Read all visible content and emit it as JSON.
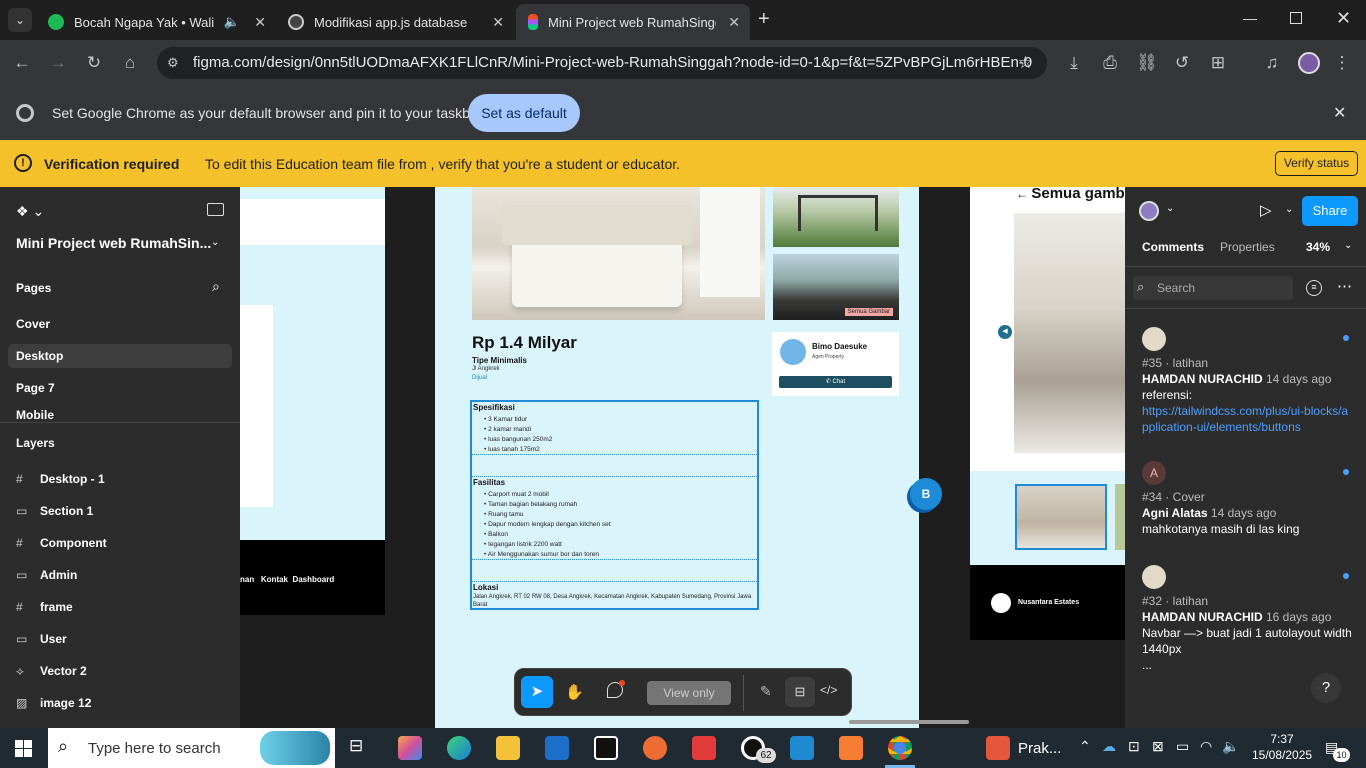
{
  "tabs": [
    {
      "title": "Bocah Ngapa Yak • Wali",
      "color": "#1db954"
    },
    {
      "title": "Modifikasi app.js database",
      "color": "#d0d0d0"
    },
    {
      "title": "Mini Project web RumahSinggah",
      "color": "#f24e1e"
    }
  ],
  "address": {
    "url": "figma.com/design/0nn5tlUODmaAFXK1FLlCnR/Mini-Project-web-RumahSinggah?node-id=0-1&p=f&t=5ZPvBPGjLm6rHBEn-0"
  },
  "infobar": {
    "text": "Set Google Chrome as your default browser and pin it to your taskbar",
    "button": "Set as default"
  },
  "verification": {
    "title": "Verification required",
    "text": "To edit this Education team file from , verify that you're a student or educator.",
    "button": "Verify status"
  },
  "left_panel": {
    "file_name": "Mini Project web RumahSin...",
    "pages_heading": "Pages",
    "pages": [
      "Cover",
      "Desktop",
      "Page 7",
      "Mobile"
    ],
    "layers_heading": "Layers",
    "layers": [
      {
        "icon": "#",
        "label": "Desktop - 1"
      },
      {
        "icon": "▭",
        "label": "Section 1"
      },
      {
        "icon": "#",
        "label": "Component"
      },
      {
        "icon": "▭",
        "label": "Admin"
      },
      {
        "icon": "#",
        "label": "frame"
      },
      {
        "icon": "▭",
        "label": "User"
      },
      {
        "icon": "⟡",
        "label": "Vector 2"
      },
      {
        "icon": "▨",
        "label": "image 12"
      }
    ]
  },
  "canvas": {
    "left_footer_links": "nan   Kontak  Dashboard",
    "price": "Rp 1.4 Milyar",
    "type": "Tipe Minimalis",
    "street": "Jl Angkrek",
    "status": "Dijual",
    "agent_name": "Bimo Daesuke",
    "agent_role": "Agen Property",
    "chat": "Chat",
    "all_photos_badge": "Semua Gambar",
    "spec_title": "Spesifikasi",
    "specs": [
      "3 Kamar tidur",
      "2 kamar mandi",
      "luas bangunan 250m2",
      "luas tanah 175m2"
    ],
    "facility_title": "Fasilitas",
    "facilities": [
      "Carport muat 2 mobil",
      "Taman bagian belakang rumah",
      "Ruang tamu",
      "Dapur modern lengkap dengan kitchen set",
      "Balkon",
      "tegangan listrik 2200 watt",
      "Air Menggunakan sumur bor dan toren"
    ],
    "location_title": "Lokasi",
    "location_text": "Jalan Angkrek, RT 02 RW 08, Desa Angkrek, Kecamatan Angkrek, Kabupaten Sumedang, Provinsi Jawa Barat",
    "right_header": "Semua gamb",
    "right_footer_brand": "Nusantara Estates",
    "user_badge": "B"
  },
  "toolbar": {
    "view_only": "View only"
  },
  "right_panel": {
    "share": "Share",
    "tab_comments": "Comments",
    "tab_properties": "Properties",
    "zoom": "34%",
    "search_placeholder": "Search",
    "comments": [
      {
        "avatar": "",
        "meta": "#35 · latihan",
        "author": "HAMDAN NURACHID",
        "time": "14 days ago",
        "body": "referensi:",
        "link": "https://tailwindcss.com/plus/ui-blocks/application-ui/elements/buttons"
      },
      {
        "avatar": "A",
        "meta": "#34 · Cover",
        "author": "Agni Alatas",
        "time": "14 days ago",
        "body": "mahkotanya masih di las king",
        "link": ""
      },
      {
        "avatar": "",
        "meta": "#32 · latihan",
        "author": "HAMDAN NURACHID",
        "time": "16 days ago",
        "body": "Navbar —> buat jadi 1 autolayout width 1440px",
        "link": "..."
      }
    ],
    "help": "?"
  },
  "taskbar": {
    "search_placeholder": "Type here to search",
    "whatsapp_badge": "62",
    "praktikum": "Prak...",
    "time": "7:37",
    "date": "15/08/2025",
    "notifications": "10"
  }
}
